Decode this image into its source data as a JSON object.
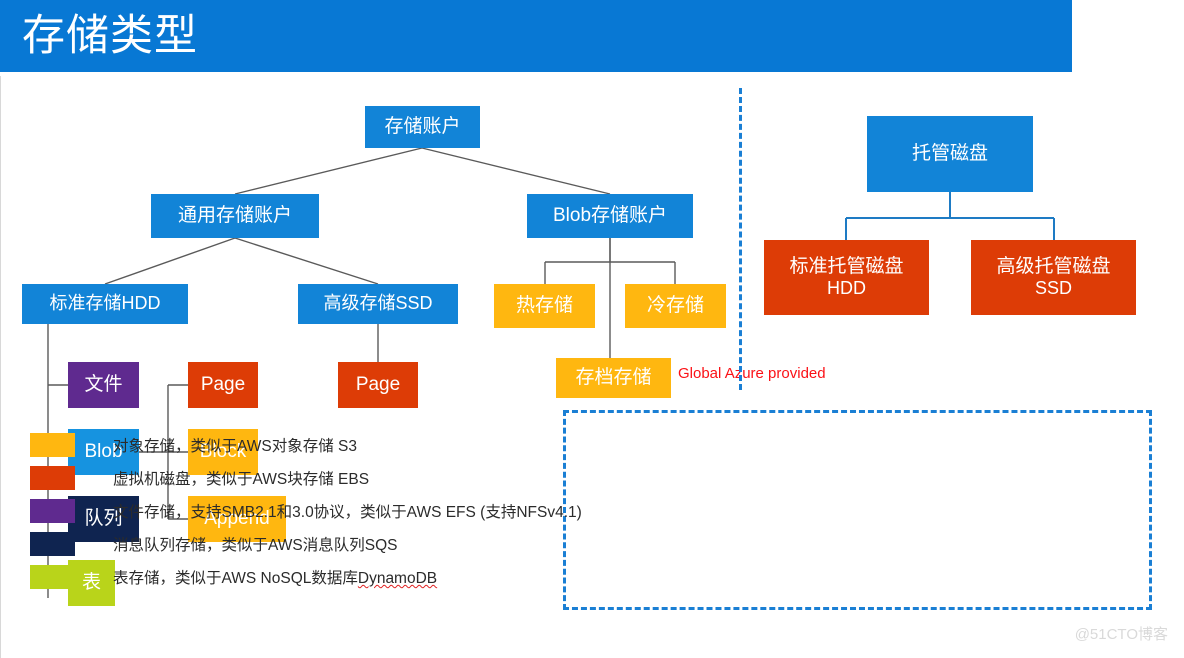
{
  "header": {
    "title": "存储类型",
    "background_color": "#0878d4",
    "text_color": "#ffffff"
  },
  "colors": {
    "blue": "#1284d7",
    "light_blue": "#1693e0",
    "amber": "#ffb710",
    "orange": "#dd3c06",
    "purple": "#5f2a8f",
    "navy": "#0f2450",
    "lime": "#b9d41a",
    "dashed_divider": "#1a7fd4",
    "connector_gray": "#5a5a5a",
    "connector_blue": "#1e7bc4",
    "red_note": "#fb1116",
    "watermark": "#d9d9d9"
  },
  "storage_tree": {
    "root": "存储账户",
    "general_purpose": "通用存储账户",
    "blob_account": "Blob存储账户",
    "standard_hdd": "标准存储HDD",
    "premium_ssd": "高级存储SSD",
    "standard_children": [
      "文件",
      "Blob",
      "队列",
      "表"
    ],
    "blob_types": [
      "Page",
      "Block",
      "Append"
    ],
    "premium_child": "Page",
    "blob_tiers": [
      "热存储",
      "冷存储"
    ],
    "archive_tier": "存档存储",
    "archive_note": "Global Azure provided"
  },
  "managed_disk": {
    "root": "托管磁盘",
    "children": [
      {
        "title": "标准托管磁盘",
        "subtitle": "HDD"
      },
      {
        "title": "高级托管磁盘",
        "subtitle": "SSD"
      }
    ]
  },
  "legend": {
    "items": [
      {
        "color": "#ffb710",
        "text": "对象存储，类似于AWS对象存储 S3"
      },
      {
        "color": "#dd3c06",
        "text": "虚拟机磁盘，类似于AWS块存储 EBS"
      },
      {
        "color": "#5f2a8f",
        "text": "文件存储，支持SMB2.1和3.0协议，类似于AWS EFS (支持NFSv4.1)"
      },
      {
        "color": "#0f2450",
        "text": "消息队列存储，类似于AWS消息队列SQS"
      },
      {
        "color": "#b9d41a",
        "text": "表存储，类似于AWS NoSQL数据库",
        "suffix": "DynamoDB"
      }
    ]
  },
  "watermark": "@51CTO博客"
}
